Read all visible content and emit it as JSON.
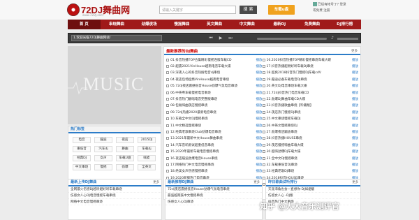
{
  "header": {
    "brand": "72DJ舞曲网",
    "sub": "www.72DJ.com",
    "search_placeholder": "请输入关键字",
    "search_label": "搜 索",
    "download_label": "车载u盘",
    "user_line1": "已经有帐号了? 登录",
    "user_line2": "或免费 注册"
  },
  "nav": [
    "首 页",
    "串烧舞曲",
    "劲爆夜场",
    "慢摇舞曲",
    "英文舞曲",
    "中文舞曲",
    "最新DJ",
    "免费舞曲",
    "DJ排行榜"
  ],
  "player": {
    "now_playing": "1.欢迎光临72DJ舞曲网站!"
  },
  "art": {
    "text": "MUSIC"
  },
  "tags": {
    "title": "热门标签",
    "items": [
      "电音",
      "蹦迪",
      "夜店",
      "2015DJ",
      "重低音",
      "汽车dj",
      "舞曲",
      "车载dj",
      "经典DJ",
      "女声",
      "车载U盘",
      "喊麦",
      "中文串烧",
      "慢摇",
      "劲爆",
      "全英文"
    ]
  },
  "list": {
    "title": "最新推荐的DJ舞曲",
    "more": "更多",
    "play": "播放",
    "left": [
      "01.抖音热播TOP合集精彩慢摇连版车载CD",
      "02.超震2021VinHouse越南电音车载大碟",
      "03.深夜入心的抖音热搜电音dj串烧",
      "04.夜店包场超燃VinHouse越南电音串烧",
      "05.72dj夜店震撼低音House劲爆气氛电音串烧",
      "06.中英粤车载慢摇电音串烧",
      "07.抖音热门翻唱电音完整版串烧",
      "08.包厢嗨曲夜店慢摇串烧",
      "09.72dj热播2020最新电音串烧",
      "10.车载全中文DJ慢摇串烧",
      "11.中文精选慢摇串烧",
      "12.经典老歌串烧Club劲爆电音串烧",
      "13.2021年最新中文House舞曲串烧",
      "14.汽车音响测试超重低音串烧",
      "15.2020年最新车载电音慢摇串烧",
      "16.夜店蹦迪劲爆电音House串烧",
      "17.网络热门中文电音慢摇串烧",
      "18.绝美女声伤感慢摇串烧",
      "19.2020新版热门电音串烧",
      "20.2020年全网最火中文DJ串烧"
    ],
    "right": [
      "16.2020抖音热播TOP精彩慢摇串烧车载大碟",
      "17.抖音热播超燃好听车载DJ串烧",
      "18.超爽2018抖音热门慢摇DJ车载cdV",
      "19.蹦迪必备车载电音DJ串烧",
      "20.英文DJ电音串烧车载大碟",
      "21.72dj抖音热门电音车载CD",
      "22.劲爆DJ舞曲车载CD大碟",
      "23.抖音热播歌曲串烧【珍藏版】",
      "24.夜店热门慢摇DJ串烧",
      "25.中文串烧慢摇车载DJ",
      "26.中英文慢摇串烧DJ",
      "27.劲爆夜店蹦迪串烧",
      "28.抖音热播HOUSE串烧",
      "29.夜店慢摇嗨曲车载大碟",
      "30.超嗨劲爆DJ车载大碟",
      "31.全中文DJ慢摇串烧",
      "32.车载重低音DJ串烧",
      "33.经典老歌DJ串烧",
      "34.2018抖音HOUSE串烧",
      "35.72DJ抖音热门串烧"
    ],
    "footer_buttons": [
      "全选",
      "反选",
      "播放选中",
      "加入列表"
    ]
  },
  "panels": [
    {
      "title": "最新上传DJ舞曲",
      "more": "更多",
      "items": [
        "全网最火伤感DJ越听越好听车载串烧",
        "伤感女人心DJ电音慢摇车载串烧",
        "网络中文电音慢摇串烧"
      ]
    },
    {
      "title": "最新推荐DJ舞曲",
      "more": "更多",
      "items": [
        "72dj夜店震撼低音House劲爆气氛电音串烧",
        "最强越南鼓中文慢摇串烧",
        "伤感女人心DJ串烧"
      ]
    },
    {
      "title": "会员收藏DJ舞曲",
      "more": "更多",
      "items": [
        "中英文慢摇串烧",
        "抖音热门伤感串烧",
        "汽车DJ车载串烧"
      ]
    },
    {
      "title": "昨日歌曲试听排行",
      "more": "更多",
      "items": [
        "天涯海角也会一直想你-DJ如烟版",
        "伤感女人心 -DJ版",
        "抖音热门中文串烧"
      ]
    }
  ],
  "watermark": "知乎 @大大音乐测评官"
}
